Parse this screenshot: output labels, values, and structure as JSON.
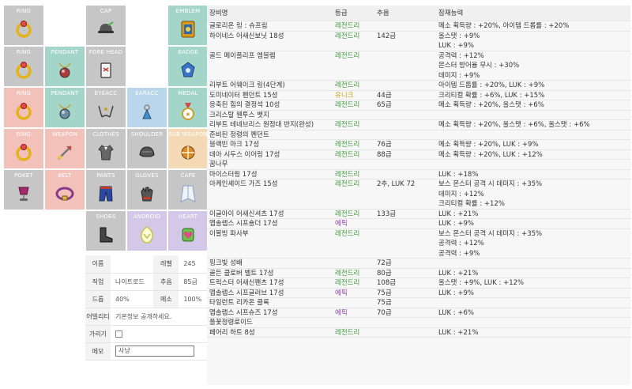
{
  "equipment_slots": [
    {
      "key": "ring1",
      "label": "RING",
      "bg": "#c6c6c6",
      "icon": "ring-icon",
      "icon_color": "#e4b21a"
    },
    {
      "key": "cap",
      "label": "CAP",
      "bg": "#c6c6c6",
      "icon": "cap-icon",
      "icon_color": "#555555"
    },
    {
      "key": "emblem",
      "label": "EMBLEM",
      "bg": "#a3d6c9",
      "icon": "emblem-icon",
      "icon_color": "#d69b1d"
    },
    {
      "key": "ring2",
      "label": "RING",
      "bg": "#c6c6c6",
      "icon": "ring-icon",
      "icon_color": "#e4b21a"
    },
    {
      "key": "pendant1",
      "label": "PENDANT",
      "bg": "#a3d6c9",
      "icon": "pendant-icon",
      "icon_color": "#b03a3a"
    },
    {
      "key": "forehead",
      "label": "FORE HEAD",
      "bg": "#c6c6c6",
      "icon": "forehead-icon",
      "icon_color": "#c0392b"
    },
    {
      "key": "badge",
      "label": "BADGE",
      "bg": "#a3d6c9",
      "icon": "badge-icon",
      "icon_color": "#3b74c4"
    },
    {
      "key": "ring3",
      "label": "RING",
      "bg": "#f2c1b9",
      "icon": "ring-icon",
      "icon_color": "#e4b21a"
    },
    {
      "key": "pendant2",
      "label": "PENDANT",
      "bg": "#a3d6c9",
      "icon": "pendant-icon",
      "icon_color": "#6b8fa8"
    },
    {
      "key": "eyeacc",
      "label": "EYEACC",
      "bg": "#c6c6c6",
      "icon": "eye-accessory-icon",
      "icon_color": "#444444"
    },
    {
      "key": "earacc",
      "label": "EARACC",
      "bg": "#b9d6ea",
      "icon": "ear-accessory-icon",
      "icon_color": "#4a90c8"
    },
    {
      "key": "medal",
      "label": "MEDAL",
      "bg": "#a3d6c9",
      "icon": "medal-icon",
      "icon_color": "#c9a02a"
    },
    {
      "key": "ring4",
      "label": "RING",
      "bg": "#f2c1b9",
      "icon": "ring-icon",
      "icon_color": "#e4b21a"
    },
    {
      "key": "weapon",
      "label": "WEAPON",
      "bg": "#f2c1b9",
      "icon": "weapon-icon",
      "icon_color": "#c24a4a"
    },
    {
      "key": "clothes",
      "label": "CLOTHES",
      "bg": "#c6c6c6",
      "icon": "clothes-icon",
      "icon_color": "#666666"
    },
    {
      "key": "shoulder",
      "label": "SHOULDER",
      "bg": "#c6c6c6",
      "icon": "shoulder-icon",
      "icon_color": "#555555"
    },
    {
      "key": "subweapon",
      "label": "SUB WEAPON",
      "bg": "#f4d9b7",
      "icon": "subweapon-icon",
      "icon_color": "#d98a2a"
    },
    {
      "key": "poket",
      "label": "POKET",
      "bg": "#c6c6c6",
      "icon": "pocket-icon",
      "icon_color": "#a22a6a"
    },
    {
      "key": "belt",
      "label": "BELT",
      "bg": "#f2c1b9",
      "icon": "belt-icon",
      "icon_color": "#8b3a8b"
    },
    {
      "key": "pants",
      "label": "PANTS",
      "bg": "#c6c6c6",
      "icon": "pants-icon",
      "icon_color": "#2e4aa0"
    },
    {
      "key": "gloves",
      "label": "GLOVES",
      "bg": "#c6c6c6",
      "icon": "gloves-icon",
      "icon_color": "#555555"
    },
    {
      "key": "cape",
      "label": "CAPE",
      "bg": "#c6c6c6",
      "icon": "cape-icon",
      "icon_color": "#9aa8c8"
    },
    {
      "key": "shoes",
      "label": "SHOES",
      "bg": "#c6c6c6",
      "icon": "shoes-icon",
      "icon_color": "#444444"
    },
    {
      "key": "android",
      "label": "ANDROID",
      "bg": "#d4c8e8",
      "icon": "android-icon",
      "icon_color": "#c9c24a"
    },
    {
      "key": "heart",
      "label": "HEART",
      "bg": "#d4c8e8",
      "icon": "heart-icon",
      "icon_color": "#6cc24a"
    }
  ],
  "char_info": {
    "name_label": "이름",
    "level_label": "레벨",
    "level": "245",
    "job_label": "직업",
    "job": "나이트로드",
    "pop_label": "추옵",
    "pop": "85급",
    "drop_label": "드롭",
    "drop": "40%",
    "meso_label": "메소",
    "meso": "100%",
    "ability_label": "어빌리티",
    "ability": "기본정보 공개하세요.",
    "hide_label": "가리기",
    "memo_label": "메모",
    "memo": "사냥"
  },
  "item_table": {
    "headers": {
      "name": "장비명",
      "grade": "등급",
      "star": "추옵",
      "potential": "잠재능력"
    },
    "rows": [
      {
        "name": "글로리온 링 : 슈프림",
        "grade": "레전드리",
        "grade_type": "legend",
        "star": "",
        "potential": [
          "메소 획득량 : +20%, 아이템 드롭률 : +20%"
        ]
      },
      {
        "name": "하이네스 어새신보닛 18성",
        "grade": "레전드리",
        "grade_type": "legend",
        "star": "142급",
        "potential": [
          "올스탯 : +9%",
          "LUK : +9%"
        ]
      },
      {
        "name": "골드 메이플리프 엠블렘",
        "grade": "레전드리",
        "grade_type": "legend",
        "star": "",
        "potential": [
          "공격력 : +12%",
          "몬스터 방어율 무시 : +30%",
          "데미지 : +9%"
        ]
      },
      {
        "name": "리부트 어웨이크 링(4단계)",
        "grade": "레전드리",
        "grade_type": "legend",
        "star": "",
        "potential": [
          "아이템 드롭률 : +20%, LUK : +9%"
        ]
      },
      {
        "name": "도미네이터 펜던트 15성",
        "grade": "유니크",
        "grade_type": "unique",
        "star": "44급",
        "potential": [
          "크리티컬 확률 : +6%, LUK : +15%"
        ]
      },
      {
        "name": "응축된 힘의 결정석 10성",
        "grade": "레전드리",
        "grade_type": "legend",
        "star": "65급",
        "potential": [
          "메소 획득량 : +20%, 올스탯 : +6%"
        ]
      },
      {
        "name": "크리스탈 웬투스 뱃지",
        "grade": "",
        "grade_type": "",
        "star": "",
        "potential": []
      },
      {
        "name": "리부트 테네브리스 원정대 반지(완성)",
        "grade": "레전드리",
        "grade_type": "legend",
        "star": "",
        "potential": [
          "메소 획득량 : +20%, 올스탯 : +6%, 올스탯 : +6%"
        ]
      },
      {
        "name": "준비된 정령의 펜던트",
        "grade": "",
        "grade_type": "",
        "star": "",
        "potential": []
      },
      {
        "name": "블랙빈 마크 17성",
        "grade": "레전드리",
        "grade_type": "legend",
        "star": "76급",
        "potential": [
          "메소 획득량 : +20%, LUK : +9%"
        ]
      },
      {
        "name": "데아 시두스 이어링 17성",
        "grade": "레전드리",
        "grade_type": "legend",
        "star": "88급",
        "potential": [
          "메소 획득량 : +20%, LUK : +12%"
        ]
      },
      {
        "name": "꿈나무",
        "grade": "",
        "grade_type": "",
        "star": "",
        "potential": []
      },
      {
        "name": "마이스터링 17성",
        "grade": "레전드리",
        "grade_type": "legend",
        "star": "",
        "potential": [
          "LUK : +18%"
        ]
      },
      {
        "name": "아케인셰이드 가즈 15성",
        "grade": "레전드리",
        "grade_type": "legend",
        "star": "2추, LUK 72",
        "potential": [
          "보스 몬스터 공격 시 데미지 : +35%",
          "데미지 : +12%",
          "크리티컬 확률 : +12%"
        ]
      },
      {
        "name": "이글아이 어새신셔츠 17성",
        "grade": "레전드리",
        "grade_type": "legend",
        "star": "133급",
        "potential": [
          "LUK : +21%"
        ]
      },
      {
        "name": "앱솔랩스 시프숄더 17성",
        "grade": "에픽",
        "grade_type": "epic",
        "star": "",
        "potential": [
          "LUK : +9%"
        ]
      },
      {
        "name": "이볼빙 파사부",
        "grade": "레전드리",
        "grade_type": "legend",
        "star": "",
        "potential": [
          "보스 몬스터 공격 시 데미지 : +35%",
          "공격력 : +12%",
          "공격력 : +9%"
        ]
      },
      {
        "name": "핑크빛 성배",
        "grade": "",
        "grade_type": "",
        "star": "72급",
        "potential": []
      },
      {
        "name": "골든 클로버 벨트 17성",
        "grade": "레전드리",
        "grade_type": "legend",
        "star": "80급",
        "potential": [
          "LUK : +21%"
        ]
      },
      {
        "name": "트릭스터 어새신팬츠 17성",
        "grade": "레전드리",
        "grade_type": "legend",
        "star": "108급",
        "potential": [
          "올스탯 : +9%, LUK : +12%"
        ]
      },
      {
        "name": "앱솔랩스 시프글러브 17성",
        "grade": "에픽",
        "grade_type": "epic",
        "star": "75급",
        "potential": [
          "LUK : +9%"
        ]
      },
      {
        "name": "타일런트 리카온 클록",
        "grade": "",
        "grade_type": "",
        "star": "75급",
        "potential": []
      },
      {
        "name": "앱솔랩스 시프슈즈 17성",
        "grade": "에픽",
        "grade_type": "epic",
        "star": "70급",
        "potential": [
          "LUK : +6%"
        ]
      },
      {
        "name": "플꽃정령로이드",
        "grade": "",
        "grade_type": "",
        "star": "",
        "potential": []
      },
      {
        "name": "페어리 하트 8성",
        "grade": "레전드리",
        "grade_type": "legend",
        "star": "",
        "potential": [
          "LUK : +21%"
        ]
      }
    ]
  }
}
